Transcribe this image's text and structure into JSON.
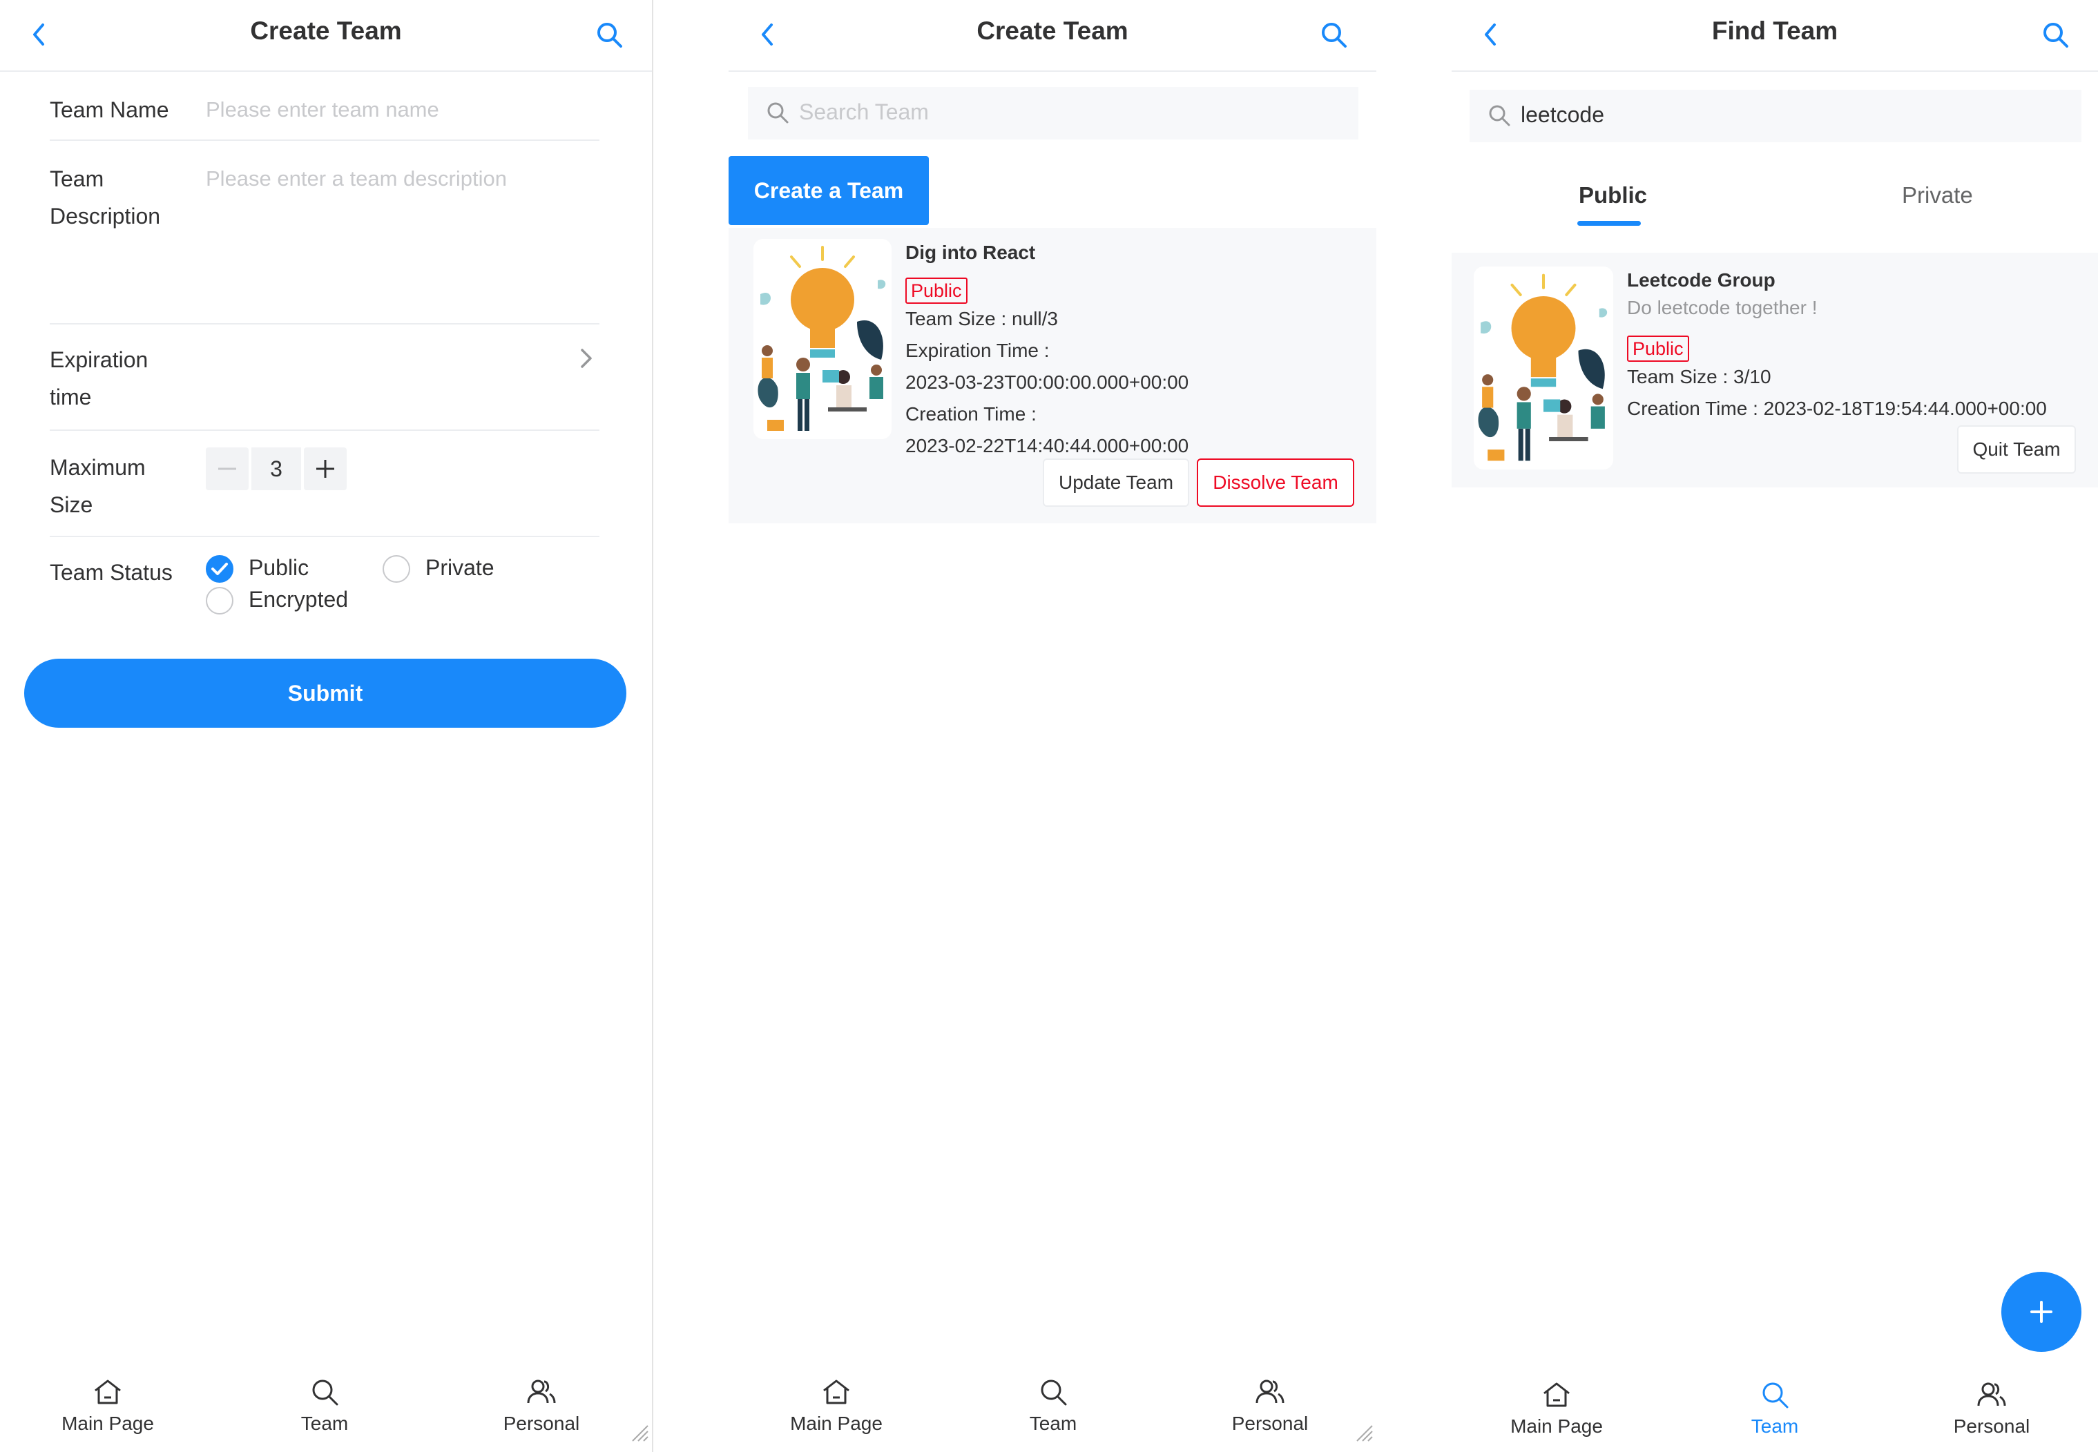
{
  "panels": {
    "create_form": {
      "title": "Create Team",
      "fields": {
        "team_name": {
          "label": "Team Name",
          "placeholder": "Please enter team name"
        },
        "team_description": {
          "label_line1": "Team",
          "label_line2": "Description",
          "placeholder": "Please enter a team description"
        },
        "expiration": {
          "label_line1": "Expiration",
          "label_line2": "time"
        },
        "max_size": {
          "label_line1": "Maximum",
          "label_line2": "Size",
          "value": "3"
        },
        "team_status": {
          "label": "Team Status",
          "options": [
            "Public",
            "Private",
            "Encrypted"
          ],
          "selected": "Public"
        }
      },
      "submit_label": "Submit"
    },
    "create_list": {
      "title": "Create Team",
      "search_placeholder": "Search Team",
      "create_button": "Create a Team",
      "card": {
        "title": "Dig into React",
        "tag": "Public",
        "team_size": "Team Size : null/3",
        "expiration_label": "Expiration Time :",
        "expiration_value": "2023-03-23T00:00:00.000+00:00",
        "creation_label": "Creation Time :",
        "creation_value": "2023-02-22T14:40:44.000+00:00",
        "update_button": "Update Team",
        "dissolve_button": "Dissolve Team"
      }
    },
    "find_team": {
      "title": "Find Team",
      "search_value": "leetcode",
      "tabs": [
        "Public",
        "Private"
      ],
      "active_tab": "Public",
      "card": {
        "title": "Leetcode Group",
        "description": "Do leetcode together !",
        "tag": "Public",
        "team_size": "Team Size : 3/10",
        "creation": "Creation Time : 2023-02-18T19:54:44.000+00:00",
        "quit_button": "Quit Team"
      },
      "fab_icon": "plus-icon"
    }
  },
  "tabbar": {
    "items": [
      "Main Page",
      "Team",
      "Personal"
    ]
  },
  "colors": {
    "primary": "#1989fa",
    "danger": "#ee0a24",
    "placeholder": "#c8c9cc",
    "text": "#323233",
    "background_light": "#f7f8fa"
  }
}
